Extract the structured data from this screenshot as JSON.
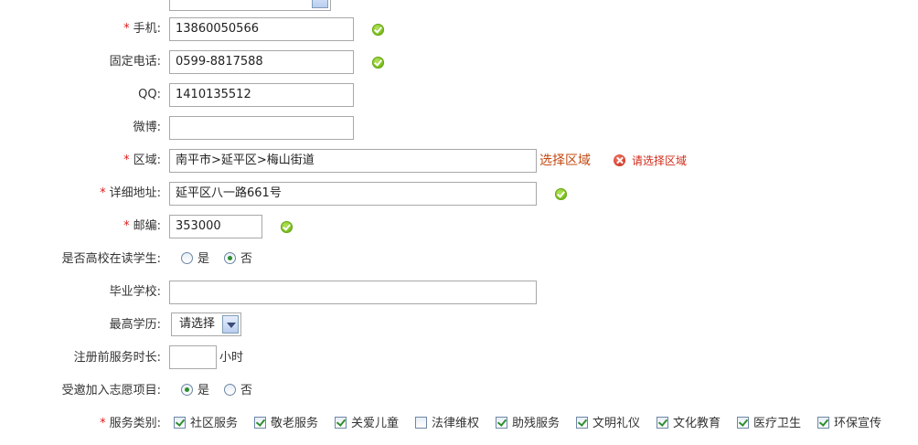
{
  "form": {
    "mobile": {
      "label": "手机:",
      "value": "13860050566"
    },
    "phone": {
      "label": "固定电话:",
      "value": "0599-8817588"
    },
    "qq": {
      "label": "QQ:",
      "value": "1410135512"
    },
    "weibo": {
      "label": "微博:",
      "value": ""
    },
    "region": {
      "label": "区域:",
      "value": "南平市>延平区>梅山街道",
      "choose_link": "选择区域",
      "error": "请选择区域"
    },
    "address": {
      "label": "详细地址:",
      "value": "延平区八一路661号"
    },
    "postcode": {
      "label": "邮编:",
      "value": "353000"
    },
    "student": {
      "label": "是否高校在读学生:",
      "yes": "是",
      "no": "否",
      "selected": "no"
    },
    "school": {
      "label": "毕业学校:",
      "value": ""
    },
    "education": {
      "label": "最高学历:",
      "selected": "请选择"
    },
    "service_hours": {
      "label": "注册前服务时长:",
      "value": "",
      "unit": "小时"
    },
    "invited": {
      "label": "受邀加入志愿项目:",
      "yes": "是",
      "no": "否",
      "selected": "yes"
    },
    "service_types": {
      "label": "服务类别:",
      "items": [
        {
          "label": "社区服务",
          "checked": true
        },
        {
          "label": "敬老服务",
          "checked": true
        },
        {
          "label": "关爱儿童",
          "checked": true
        },
        {
          "label": "法律维权",
          "checked": false
        },
        {
          "label": "助残服务",
          "checked": true
        },
        {
          "label": "文明礼仪",
          "checked": true
        },
        {
          "label": "文化教育",
          "checked": true
        },
        {
          "label": "医疗卫生",
          "checked": true
        },
        {
          "label": "环保宣传",
          "checked": true
        }
      ]
    },
    "required_mark": "*"
  },
  "colors": {
    "required": "#e01a1a",
    "link": "#c24a12",
    "error": "#d12b1a",
    "ok": "#7cc01e"
  }
}
